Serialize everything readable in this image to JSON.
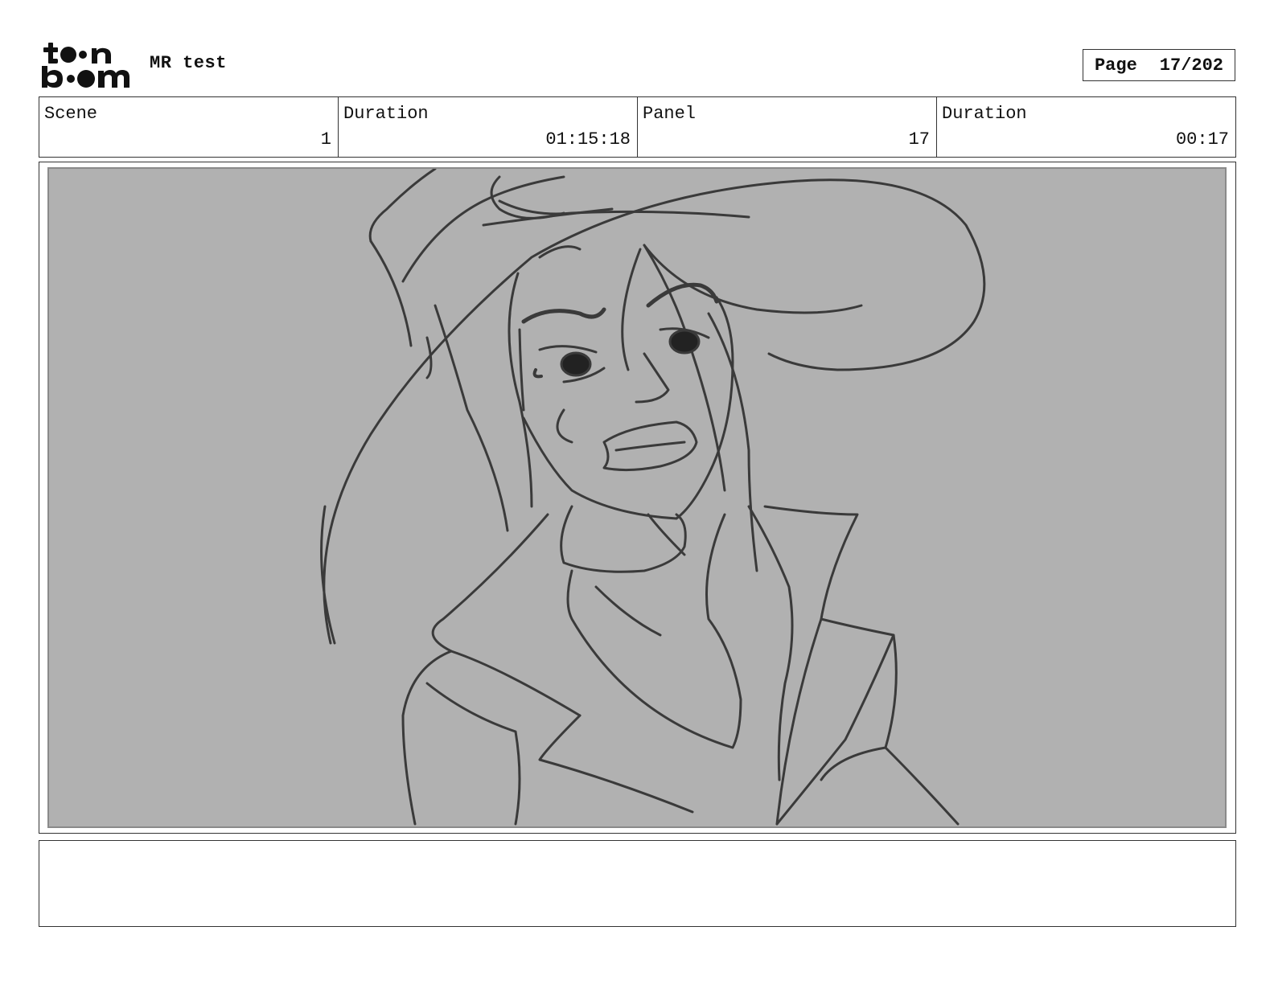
{
  "header": {
    "logo": {
      "line1": "toon",
      "line2": "boom"
    },
    "project_title": "MR test",
    "page_label": "Page",
    "page_number": "17/202"
  },
  "info": {
    "scene_label": "Scene",
    "scene_value": "1",
    "scene_duration_label": "Duration",
    "scene_duration_value": "01:15:18",
    "panel_label": "Panel",
    "panel_value": "17",
    "panel_duration_label": "Duration",
    "panel_duration_value": "00:17"
  },
  "panel": {
    "background_color": "#b1b1b1",
    "line_color": "#3a3a3a"
  },
  "notes": {
    "text": ""
  }
}
